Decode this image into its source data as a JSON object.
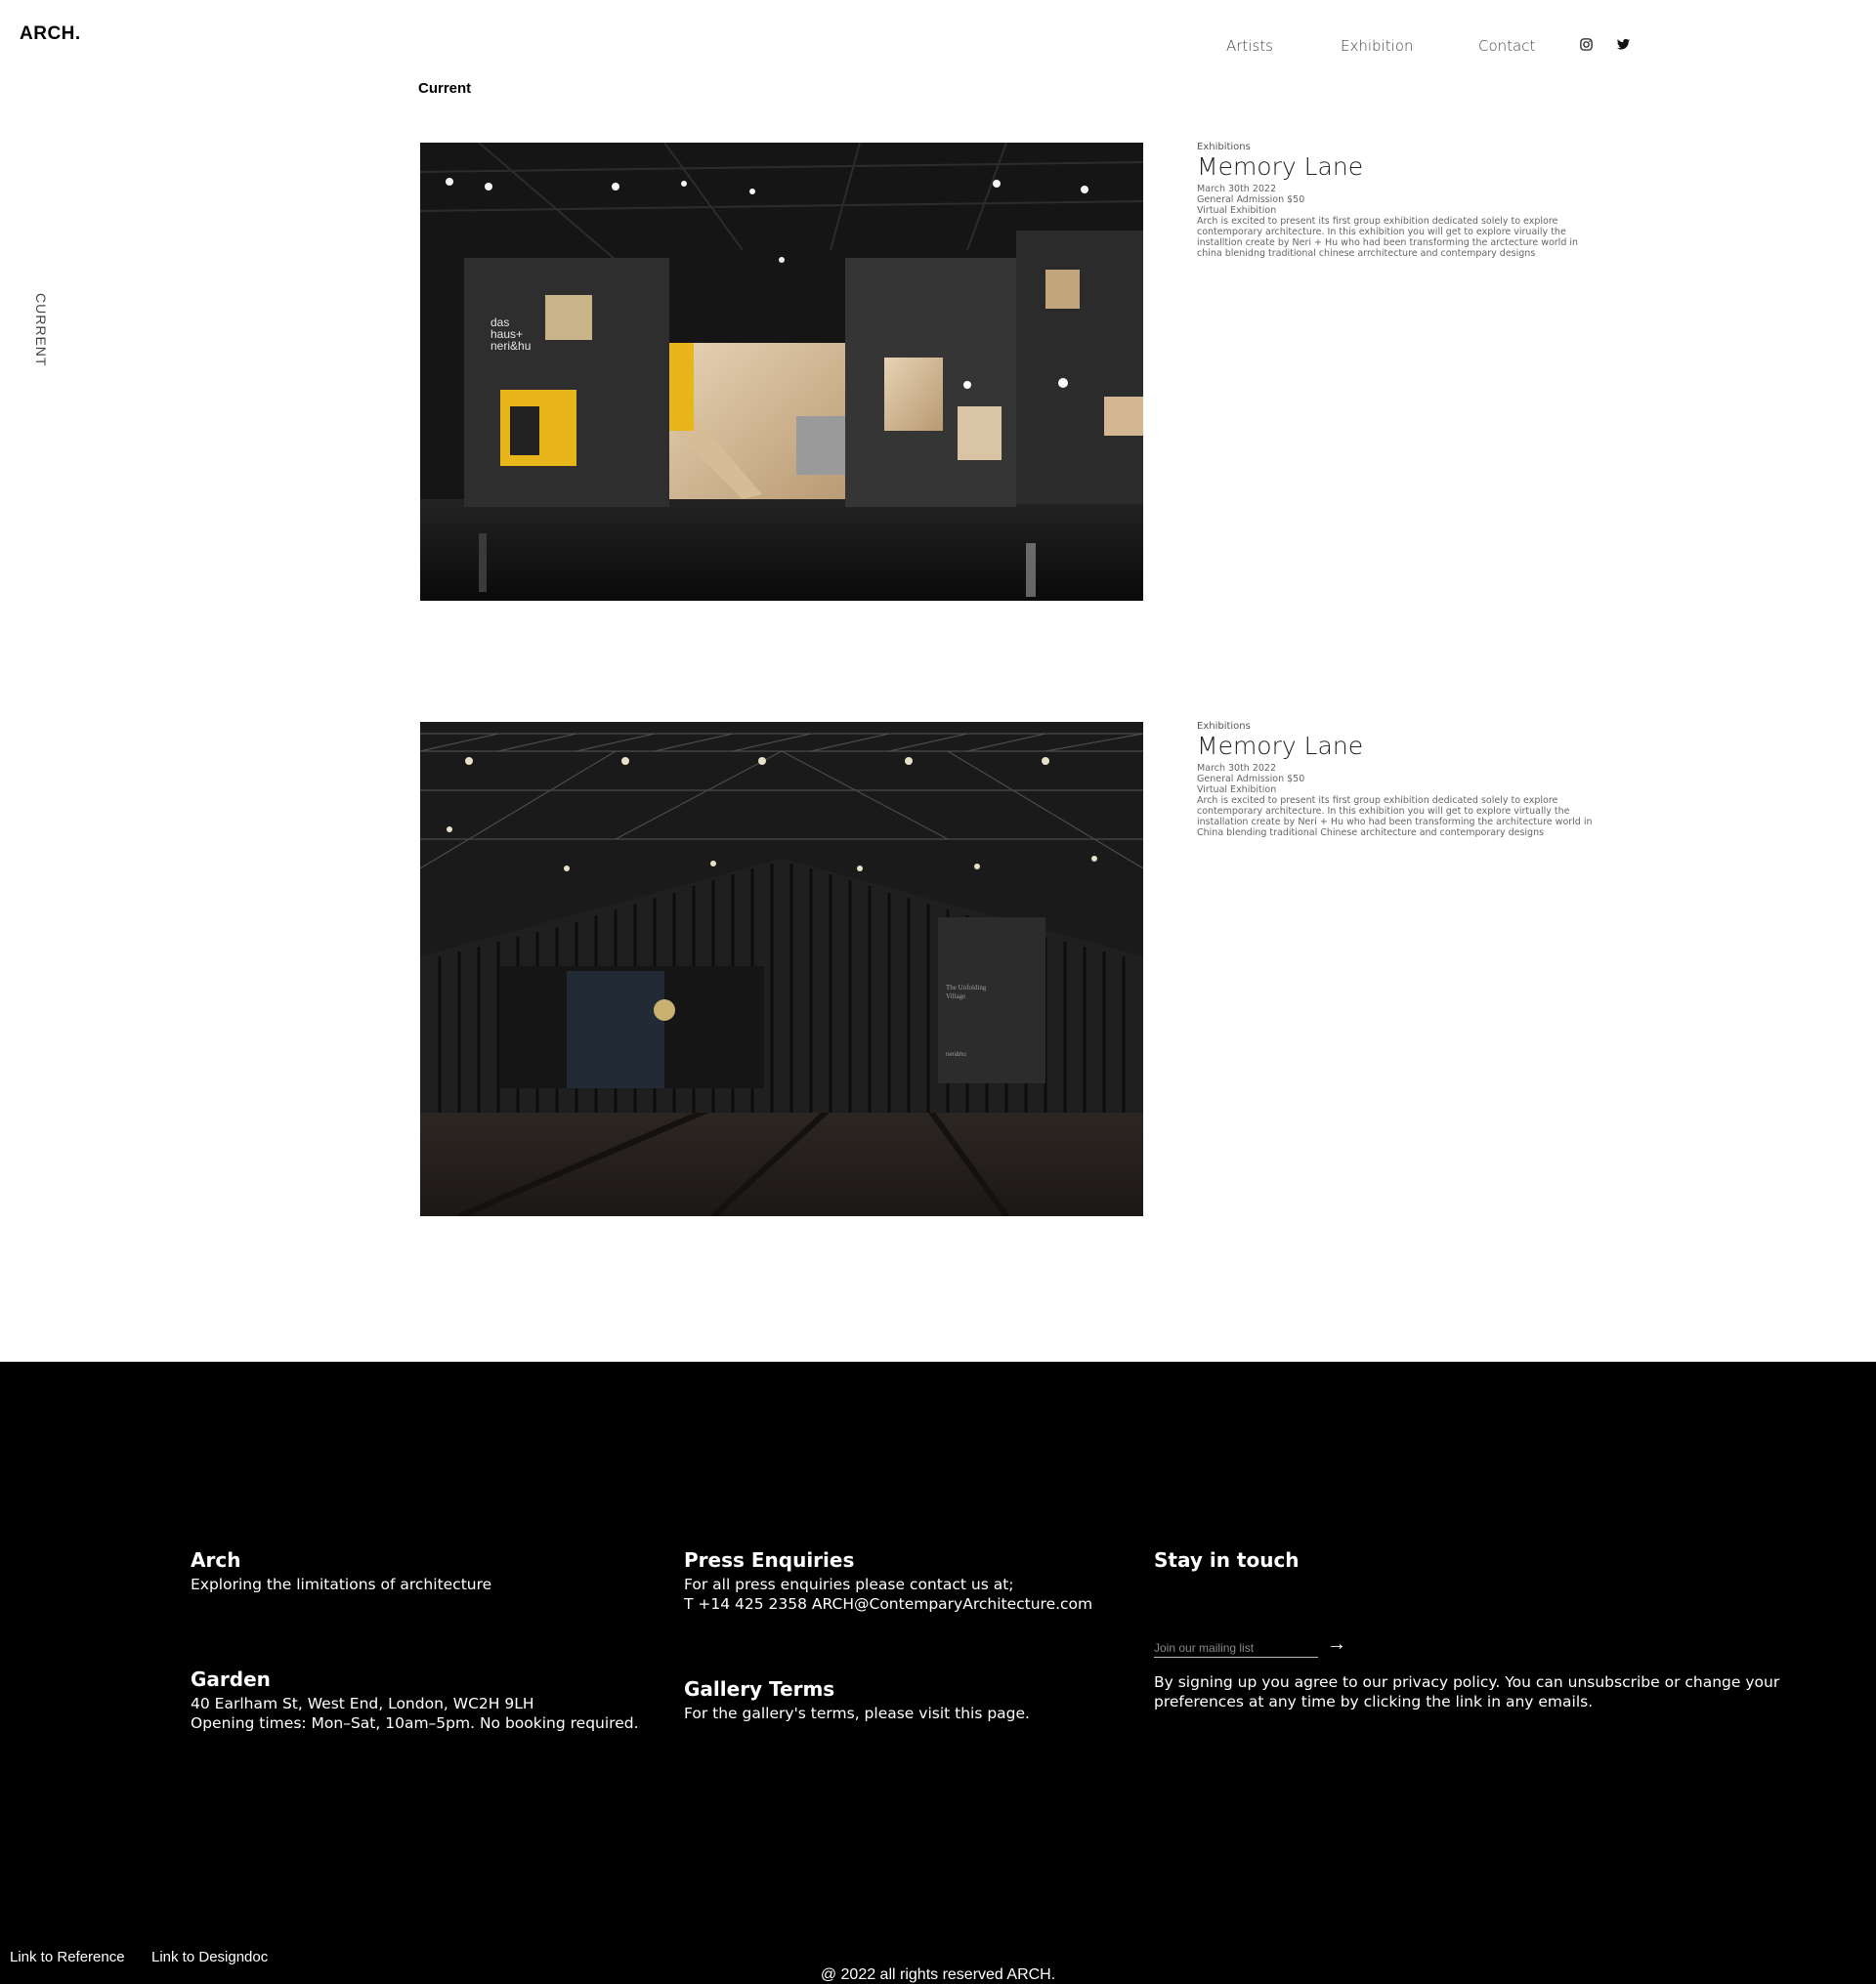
{
  "header": {
    "logo": "ARCH.",
    "nav": [
      {
        "label": "Artists"
      },
      {
        "label": "Exhibition"
      },
      {
        "label": "Contact"
      }
    ],
    "social_icons": [
      "instagram-icon",
      "twitter-icon"
    ]
  },
  "page": {
    "section_title": "Current",
    "side_label": "CURRENT"
  },
  "exhibitions": [
    {
      "category": "Exhibitions",
      "title": "Memory Lane",
      "date": "March 30th 2022",
      "admission": "General Admission $50",
      "type": "Virtual Exhibition",
      "description": "Arch is excited to present its first group exhibition dedicated solely to explore contemporary architecture. In this exhibition you will get to explore viruaily the installtion create by Neri + Hu who had been transforming the arctecture world in china blenidng traditional chinese arrchitecture and contempary designs",
      "image_sign": [
        "das",
        "haus+",
        "neri&hu"
      ]
    },
    {
      "category": "Exhibitions",
      "title": "Memory Lane",
      "date": "March 30th 2022",
      "admission": "General Admission $50",
      "type": "Virtual Exhibition",
      "description": "Arch is excited to present its first group exhibition dedicated solely to explore contemporary architecture. In this exhibition you will get to explore virtually the installation create by Neri + Hu who had been transforming the architecture world in China blending traditional Chinese architecture and contemporary designs",
      "image_sign": [
        "The Unfolding",
        "Village",
        "neri&hu"
      ]
    }
  ],
  "footer": {
    "arch": {
      "heading": "Arch",
      "text": "Exploring the limitations of architecture"
    },
    "garden": {
      "heading": "Garden",
      "address": "40 Earlham St, West End, London, WC2H 9LH",
      "hours": "Opening times: Mon–Sat, 10am–5pm. No booking required."
    },
    "press": {
      "heading": "Press Enquiries",
      "text": "For all press enquiries please contact us at;",
      "contact": "T +14 425 2358 ARCH@ContemparyArchitecture.com"
    },
    "terms": {
      "heading": "Gallery Terms",
      "text": "For the gallery's terms, please visit this page."
    },
    "stay": {
      "heading": "Stay in touch",
      "placeholder": "Join our mailing list",
      "arrow": "→",
      "notice": "By signing up you agree to our privacy policy. You can unsubscribe or change your preferences at any time by clicking the link in any emails."
    },
    "links": [
      "Link to Reference",
      "Link to Designdoc"
    ],
    "copyright": "@ 2022 all rights reserved ARCH."
  },
  "colors": {
    "background": "#ffffff",
    "footer_background": "#000000",
    "accent_yellow": "#e8b51a"
  }
}
